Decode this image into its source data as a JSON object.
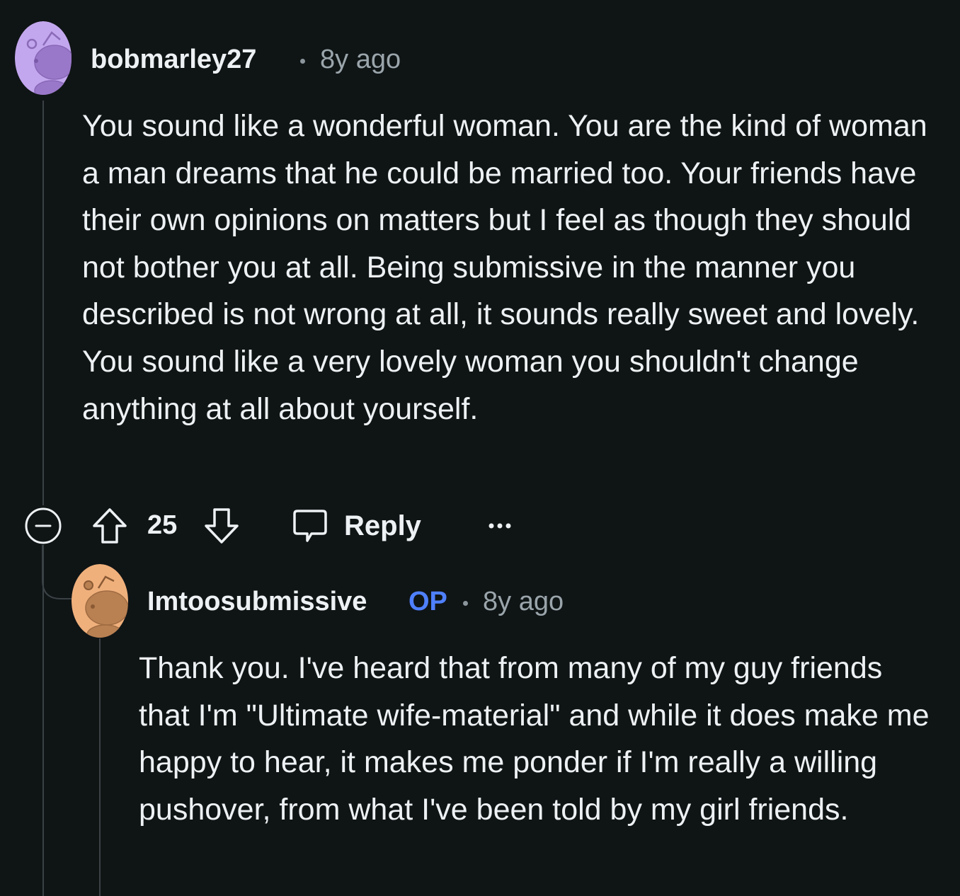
{
  "comments": [
    {
      "username": "bobmarley27",
      "timestamp": "8y ago",
      "avatar_color": "#c3a7ee",
      "avatar_figure_color": "#9a78c9",
      "body": "You sound like a wonderful woman. You are the kind of woman a man dreams that he could be married too. Your friends have their own opinions on matters but I feel as though they should not bother you at all. Being submissive in the manner you described is not wrong at all, it sounds really sweet and lovely. You sound like a very lovely woman you shouldn't change anything at all about yourself.",
      "score": "25",
      "reply_label": "Reply",
      "more_label": "···"
    },
    {
      "username": "Imtoosubmissive",
      "op_badge": "OP",
      "timestamp": "8y ago",
      "avatar_color": "#f0b07c",
      "avatar_figure_color": "#b98052",
      "body": "Thank you. I've heard that from many of my guy friends that I'm \"Ultimate wife-material\" and while it does make me happy to hear, it makes me ponder if I'm really a willing pushover, from what I've been told by my girl friends."
    }
  ],
  "colors": {
    "background": "#0f1415",
    "text": "#eef1f3",
    "meta": "#9aa5ab",
    "op": "#4f80ff",
    "thread_line": "#3a4246"
  }
}
